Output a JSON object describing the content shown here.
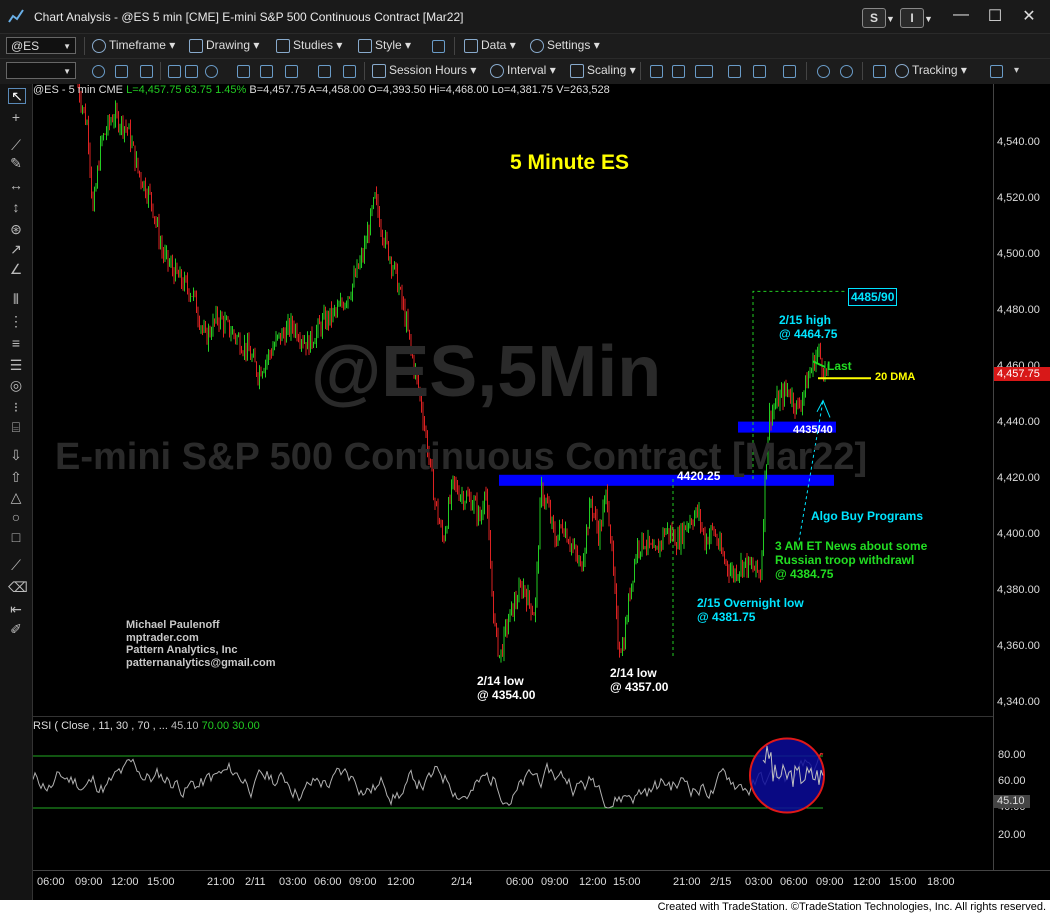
{
  "window": {
    "title": "Chart Analysis - @ES 5 min [CME] E-mini S&P 500 Continuous Contract [Mar22]",
    "btn_s": "S",
    "btn_i": "I",
    "minimize": "—",
    "restore": "☐",
    "close": "✕"
  },
  "toolbar1": {
    "symbol": "@ES",
    "timeframe": "Timeframe",
    "drawing": "Drawing",
    "studies": "Studies",
    "style": "Style",
    "data": "Data",
    "settings": "Settings"
  },
  "toolbar2": {
    "session_hours": "Session Hours",
    "interval": "Interval",
    "scaling": "Scaling",
    "tracking": "Tracking"
  },
  "header": {
    "symbol": "@ES - 5 min  CME",
    "last": "L=4,457.75",
    "change": "63.75",
    "pct": "1.45%",
    "bid": "B=4,457.75",
    "ask": "A=4,458.00",
    "open": "O=4,393.50",
    "high": "Hi=4,468.00",
    "low": "Lo=4,381.75",
    "volume": "V=263,528"
  },
  "watermark": {
    "line1": "@ES,5Min",
    "line2": "E-mini S&P 500 Continuous Contract [Mar22]"
  },
  "annotations": {
    "chart_title": "5 Minute ES",
    "target": "4485/90",
    "high_1": "2/15 high",
    "high_2": "@ 4464.75",
    "last": "Last",
    "dma": "20 DMA",
    "zone": "4435/40",
    "resistance": "4420.25",
    "algo": "Algo Buy Programs",
    "news_1": "3 AM ET News about some",
    "news_2": "Russian troop withdrawl",
    "news_3": "@ 4384.75",
    "overnight_1": "2/15 Overnight low",
    "overnight_2": "@ 4381.75",
    "low1_1": "2/14 low",
    "low1_2": "@ 4354.00",
    "low2_1": "2/14 low",
    "low2_2": "@ 4357.00"
  },
  "author": {
    "name": "Michael Paulenoff",
    "site": "mptrader.com",
    "company": "Pattern Analytics, Inc",
    "email": "patternanalytics@gmail.com"
  },
  "price_axis": [
    "4,540.00",
    "4,520.00",
    "4,500.00",
    "4,480.00",
    "4,460.00",
    "4,440.00",
    "4,420.00",
    "4,400.00",
    "4,380.00",
    "4,360.00",
    "4,340.00"
  ],
  "last_price_tag": "4,457.75",
  "rsi": {
    "label": "RSI (  Close , 11,  30 ,  70 , ...",
    "value": "45.10",
    "upper": "70.00",
    "lower": "30.00",
    "axis": [
      "80.00",
      "60.00",
      "40.00",
      "20.00"
    ],
    "tag": "45.10"
  },
  "time_axis": [
    "06:00",
    "09:00",
    "12:00",
    "15:00",
    "21:00",
    "2/11",
    "03:00",
    "06:00",
    "09:00",
    "12:00",
    "2/14",
    "06:00",
    "09:00",
    "12:00",
    "15:00",
    "21:00",
    "2/15",
    "03:00",
    "06:00",
    "09:00",
    "12:00",
    "15:00",
    "18:00"
  ],
  "footer": "Created with TradeStation. ©TradeStation Technologies, Inc. All rights reserved.",
  "colors": {
    "up": "#22cc22",
    "down": "#dd2222",
    "zone": "#0000ff",
    "annotation_cyan": "#00e5ff",
    "annotation_yellow": "#ffff00",
    "annotation_green": "#22dd22"
  }
}
